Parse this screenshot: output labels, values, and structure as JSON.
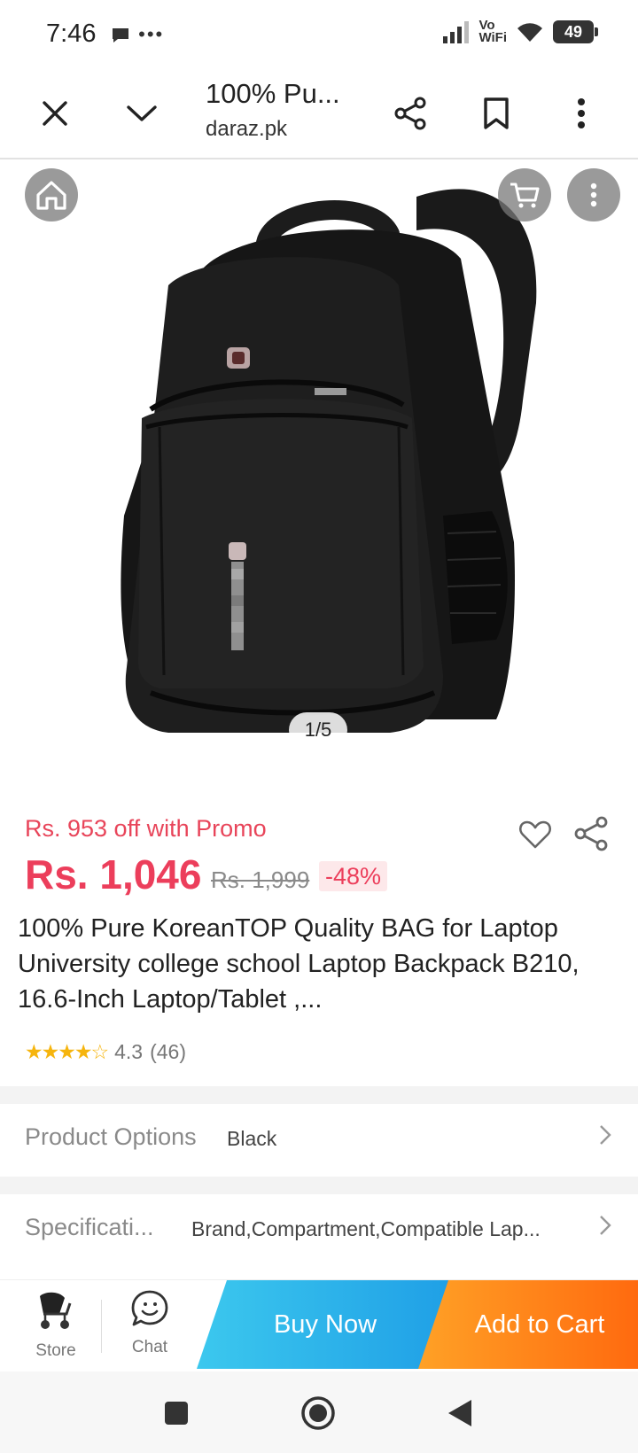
{
  "status_bar": {
    "time": "7:46",
    "left_icons": "•••",
    "vowifi_top": "Vo",
    "vowifi_bottom": "WiFi",
    "battery": "49"
  },
  "browser": {
    "title": "100% Pu...",
    "url": "daraz.pk"
  },
  "gallery": {
    "counter": "1/5"
  },
  "product": {
    "promo": "Rs. 953 off with Promo",
    "price": "Rs. 1,046",
    "old_price": "Rs. 1,999",
    "discount": "-48%",
    "title": "100% Pure KoreanTOP Quality BAG for Laptop University college school Laptop Backpack B210, 16.6-Inch Laptop/Tablet ,...",
    "rating_value": "4.3",
    "rating_count": "(46)",
    "stars": "★★★★☆"
  },
  "options": {
    "label": "Product Options",
    "value": "Black"
  },
  "specs": {
    "label": "Specificati...",
    "value": "Brand,Compartment,Compatible Lap..."
  },
  "actions": {
    "store": "Store",
    "chat": "Chat",
    "buy_now": "Buy Now",
    "add_to_cart": "Add to Cart"
  },
  "colors": {
    "price_red": "#ec3e5b",
    "buy_blue": "#1f9fe6",
    "cart_orange": "#ff6a0f"
  }
}
